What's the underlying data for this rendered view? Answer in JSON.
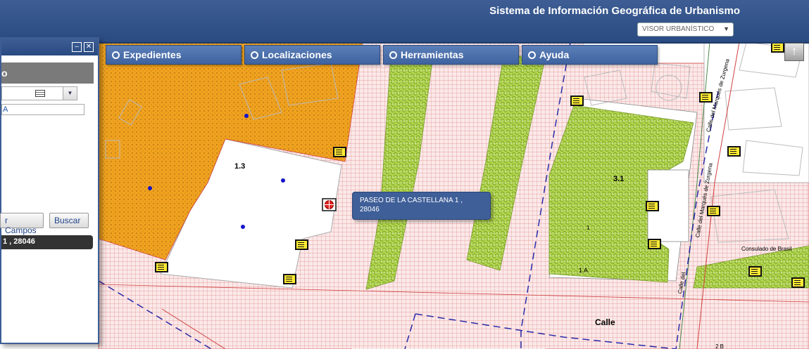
{
  "header": {
    "title": "Sistema de Información Geográfica de Urbanismo",
    "viewer_select": "VISOR URBANÍSTICO"
  },
  "menu": [
    {
      "label": "Expedientes"
    },
    {
      "label": "Localizaciones"
    },
    {
      "label": "Herramientas"
    },
    {
      "label": "Ayuda"
    }
  ],
  "panel": {
    "heading": "o",
    "input_value": "A",
    "fields_button": "r Campos",
    "search_button": "Buscar",
    "result": "1 , 28046"
  },
  "tooltip": {
    "line1": "PASEO DE LA CASTELLANA 1 ,",
    "line2": "28046"
  },
  "map": {
    "parcel_labels": [
      "1.3",
      "3.1",
      "1",
      "1 A",
      "Calle",
      "Consulado de Brasil",
      "2 B"
    ],
    "streets": [
      "Calle del Marqués de Zurgena",
      "Calle del Marqués de Zurgena",
      "Calle del"
    ],
    "colors": {
      "grid": "#e88888",
      "orange_zone": "#f0a020",
      "green_zone": "#a8cc44",
      "header": "#2e4f88",
      "info_icon": "#ffeb33",
      "marker": "#e02020"
    }
  },
  "icons": [
    "up-arrow-icon",
    "minimize-icon",
    "close-icon",
    "card-icon",
    "chevron-down-icon",
    "radio-icon",
    "info-icon",
    "location-marker-icon"
  ]
}
